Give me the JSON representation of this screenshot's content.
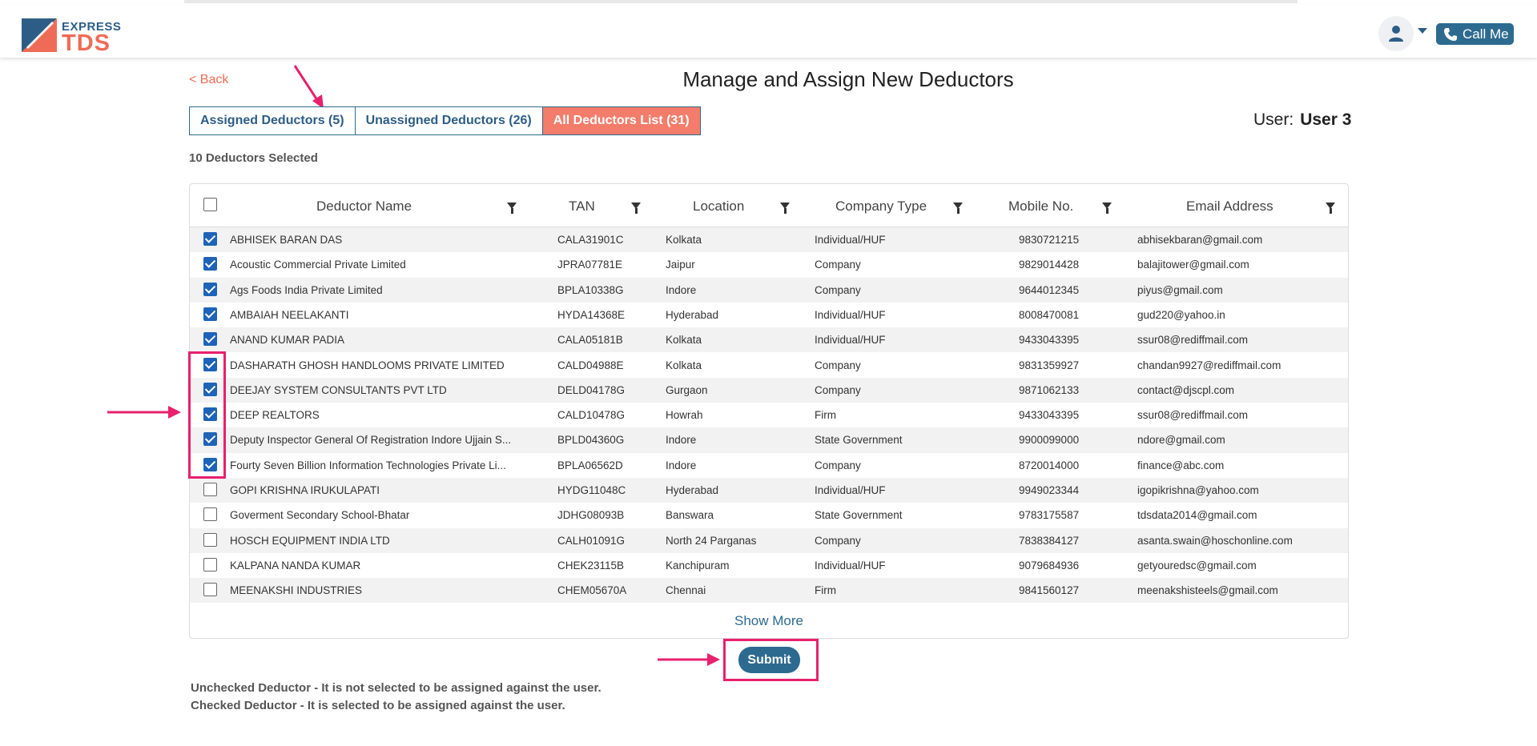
{
  "brand": {
    "line1": "EXPRESS",
    "line2": "TDS"
  },
  "header": {
    "call_label": "Call Me"
  },
  "nav": {
    "back_label": "< Back"
  },
  "page_title": "Manage and Assign New Deductors",
  "tabs": [
    {
      "label": "Assigned Deductors (5)",
      "active": false
    },
    {
      "label": "Unassigned Deductors (26)",
      "active": false
    },
    {
      "label": "All Deductors List (31)",
      "active": true
    }
  ],
  "user": {
    "label": "User:",
    "name": "User 3"
  },
  "selected_count": "10 Deductors Selected",
  "table": {
    "columns": [
      "Deductor Name",
      "TAN",
      "Location",
      "Company Type",
      "Mobile No.",
      "Email Address"
    ],
    "rows": [
      {
        "checked": true,
        "name": "ABHISEK BARAN DAS",
        "tan": "CALA31901C",
        "location": "Kolkata",
        "type": "Individual/HUF",
        "mobile": "9830721215",
        "email": "abhisekbaran@gmail.com"
      },
      {
        "checked": true,
        "name": "Acoustic Commercial Private Limited",
        "tan": "JPRA07781E",
        "location": "Jaipur",
        "type": "Company",
        "mobile": "9829014428",
        "email": "balajitower@gmail.com"
      },
      {
        "checked": true,
        "name": "Ags Foods India Private Limited",
        "tan": "BPLA10338G",
        "location": "Indore",
        "type": "Company",
        "mobile": "9644012345",
        "email": "piyus@gmail.com"
      },
      {
        "checked": true,
        "name": "AMBAIAH NEELAKANTI",
        "tan": "HYDA14368E",
        "location": "Hyderabad",
        "type": "Individual/HUF",
        "mobile": "8008470081",
        "email": "gud220@yahoo.in"
      },
      {
        "checked": true,
        "name": "ANAND KUMAR PADIA",
        "tan": "CALA05181B",
        "location": "Kolkata",
        "type": "Individual/HUF",
        "mobile": "9433043395",
        "email": "ssur08@rediffmail.com"
      },
      {
        "checked": true,
        "name": "DASHARATH GHOSH HANDLOOMS PRIVATE LIMITED",
        "tan": "CALD04988E",
        "location": "Kolkata",
        "type": "Company",
        "mobile": "9831359927",
        "email": "chandan9927@rediffmail.com"
      },
      {
        "checked": true,
        "name": "DEEJAY SYSTEM CONSULTANTS PVT LTD",
        "tan": "DELD04178G",
        "location": "Gurgaon",
        "type": "Company",
        "mobile": "9871062133",
        "email": "contact@djscpl.com"
      },
      {
        "checked": true,
        "name": "DEEP REALTORS",
        "tan": "CALD10478G",
        "location": "Howrah",
        "type": "Firm",
        "mobile": "9433043395",
        "email": "ssur08@rediffmail.com"
      },
      {
        "checked": true,
        "name": "Deputy Inspector General Of Registration Indore Ujjain S...",
        "tan": "BPLD04360G",
        "location": "Indore",
        "type": "State Government",
        "mobile": "9900099000",
        "email": "ndore@gmail.com"
      },
      {
        "checked": true,
        "name": "Fourty Seven Billion Information Technologies Private Li...",
        "tan": "BPLA06562D",
        "location": "Indore",
        "type": "Company",
        "mobile": "8720014000",
        "email": "finance@abc.com"
      },
      {
        "checked": false,
        "name": "GOPI KRISHNA IRUKULAPATI",
        "tan": "HYDG11048C",
        "location": "Hyderabad",
        "type": "Individual/HUF",
        "mobile": "9949023344",
        "email": "igopikrishna@yahoo.com"
      },
      {
        "checked": false,
        "name": "Goverment Secondary School-Bhatar",
        "tan": "JDHG08093B",
        "location": "Banswara",
        "type": "State Government",
        "mobile": "9783175587",
        "email": "tdsdata2014@gmail.com"
      },
      {
        "checked": false,
        "name": "HOSCH EQUIPMENT INDIA LTD",
        "tan": "CALH01091G",
        "location": "North 24 Parganas",
        "type": "Company",
        "mobile": "7838384127",
        "email": "asanta.swain@hoschonline.com"
      },
      {
        "checked": false,
        "name": "KALPANA NANDA KUMAR",
        "tan": "CHEK23115B",
        "location": "Kanchipuram",
        "type": "Individual/HUF",
        "mobile": "9079684936",
        "email": "getyouredsc@gmail.com"
      },
      {
        "checked": false,
        "name": "MEENAKSHI INDUSTRIES",
        "tan": "CHEM05670A",
        "location": "Chennai",
        "type": "Firm",
        "mobile": "9841560127",
        "email": "meenakshisteels@gmail.com"
      }
    ],
    "show_more_label": "Show More"
  },
  "submit_label": "Submit",
  "notes": [
    "Unchecked Deductor - It is not selected to be assigned against the user.",
    "Checked Deductor - It is selected to be assigned against the user."
  ],
  "colors": {
    "primary": "#2d6a8f",
    "accent": "#f47c6a",
    "annotation": "#e8206d",
    "checkbox": "#1e63b8"
  },
  "icons": [
    "logo-icon",
    "user-icon",
    "chevron-down-icon",
    "phone-icon",
    "filter-icon"
  ]
}
